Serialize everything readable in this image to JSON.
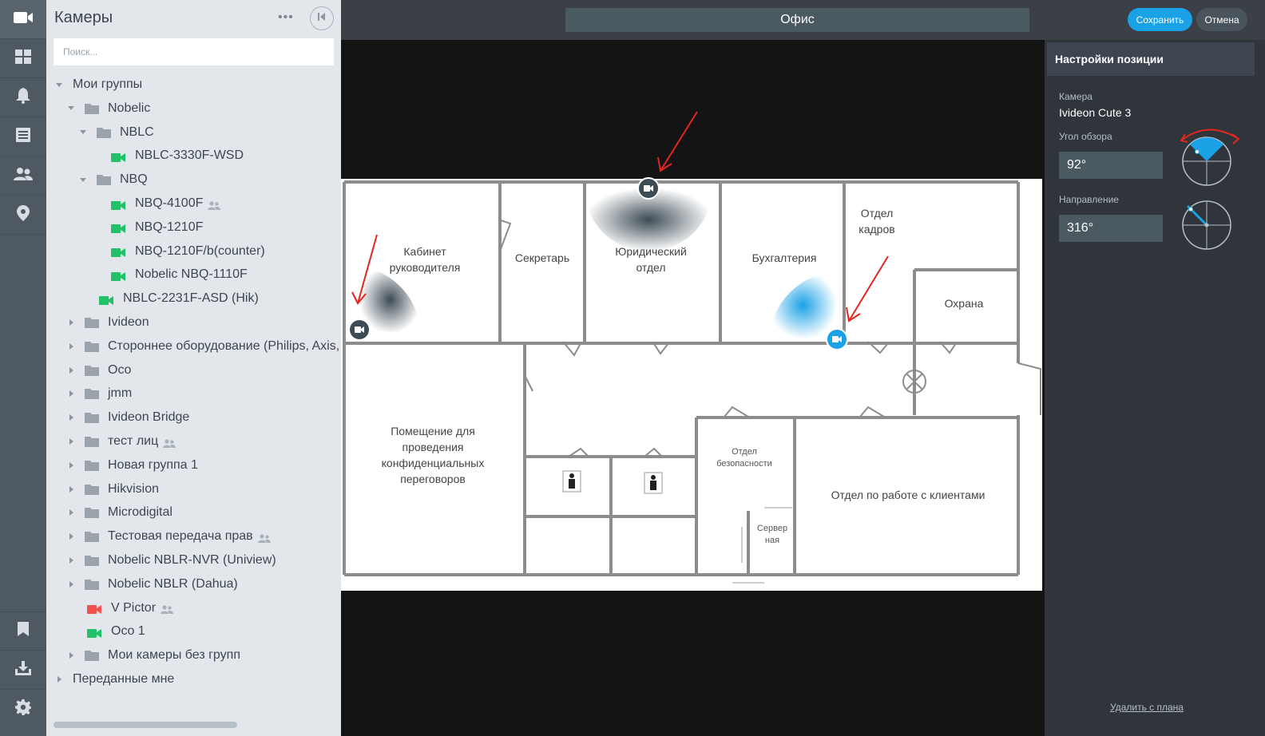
{
  "rail": {
    "items": [
      {
        "name": "camera-icon",
        "active": true
      },
      {
        "name": "dashboard-icon"
      },
      {
        "name": "bell-icon"
      },
      {
        "name": "list-icon"
      },
      {
        "name": "users-icon"
      },
      {
        "name": "location-pin-icon"
      },
      {
        "name": "bookmark-icon"
      },
      {
        "name": "download-icon"
      },
      {
        "name": "gear-icon"
      }
    ]
  },
  "panel": {
    "title": "Камеры",
    "more": "•••",
    "search_placeholder": "Поиск...",
    "tree": [
      {
        "label": "Мои группы",
        "type": "root",
        "expanded": true
      },
      {
        "label": "Nobelic",
        "type": "folder",
        "expanded": true
      },
      {
        "label": "NBLC",
        "type": "folder",
        "expanded": true
      },
      {
        "label": "NBLC-3330F-WSD",
        "type": "camera",
        "status": "online"
      },
      {
        "label": "NBQ",
        "type": "folder",
        "expanded": true
      },
      {
        "label": "NBQ-4100F",
        "type": "camera",
        "status": "online",
        "shared": true
      },
      {
        "label": "NBQ-1210F",
        "type": "camera",
        "status": "online"
      },
      {
        "label": "NBQ-1210F/b(counter)",
        "type": "camera",
        "status": "online"
      },
      {
        "label": "Nobelic NBQ-1110F",
        "type": "camera",
        "status": "online"
      },
      {
        "label": "NBLC-2231F-ASD (Hik)",
        "type": "camera",
        "status": "online"
      },
      {
        "label": "Ivideon",
        "type": "folder",
        "expanded": false
      },
      {
        "label": "Стороннее оборудование (Philips, Axis,",
        "type": "folder",
        "expanded": false
      },
      {
        "label": "Oco",
        "type": "folder",
        "expanded": false
      },
      {
        "label": "jmm",
        "type": "folder",
        "expanded": false
      },
      {
        "label": "Ivideon Bridge",
        "type": "folder",
        "expanded": false
      },
      {
        "label": "тест лиц",
        "type": "folder",
        "expanded": false,
        "shared": true
      },
      {
        "label": "Новая группа 1",
        "type": "folder",
        "expanded": false
      },
      {
        "label": "Hikvision",
        "type": "folder",
        "expanded": false
      },
      {
        "label": "Microdigital",
        "type": "folder",
        "expanded": false
      },
      {
        "label": "Тестовая передача прав",
        "type": "folder",
        "expanded": false,
        "shared": true
      },
      {
        "label": "Nobelic NBLR-NVR (Uniview)",
        "type": "folder",
        "expanded": false
      },
      {
        "label": "Nobelic NBLR (Dahua)",
        "type": "folder",
        "expanded": false
      },
      {
        "label": "V Pictor",
        "type": "camera",
        "status": "offline",
        "shared": true
      },
      {
        "label": "Oco 1",
        "type": "camera",
        "status": "online"
      },
      {
        "label": "Мои камеры без групп",
        "type": "folder",
        "expanded": false
      },
      {
        "label": "Переданные мне",
        "type": "root",
        "expanded": false
      }
    ]
  },
  "topbar": {
    "plan_name": "Офис",
    "save_label": "Сохранить",
    "cancel_label": "Отмена"
  },
  "map": {
    "rooms": {
      "director": [
        "Кабинет",
        "руководителя"
      ],
      "secretary": "Секретарь",
      "legal": [
        "Юридический",
        "отдел"
      ],
      "accounting": "Бухгалтерия",
      "hr": [
        "Отдел",
        "кадров"
      ],
      "security": "Охрана",
      "meeting": [
        "Помещение для",
        "проведения",
        "конфиденциальных",
        "переговоров"
      ],
      "safety": [
        "Отдел",
        "безопасности"
      ],
      "server": [
        "Сервер",
        "ная"
      ],
      "clients": "Отдел по работе с клиентами"
    }
  },
  "settings": {
    "title": "Настройки позиции",
    "camera_label": "Камера",
    "camera_value": "Ivideon Cute 3",
    "angle_label": "Угол обзора",
    "angle_value": "92°",
    "direction_label": "Направление",
    "direction_value": "316°",
    "delete_label": "Удалить с плана"
  },
  "colors": {
    "accent": "#1aa1e6",
    "online": "#23c06a",
    "offline": "#f0524f",
    "annotation_arrow": "#e3261f"
  }
}
